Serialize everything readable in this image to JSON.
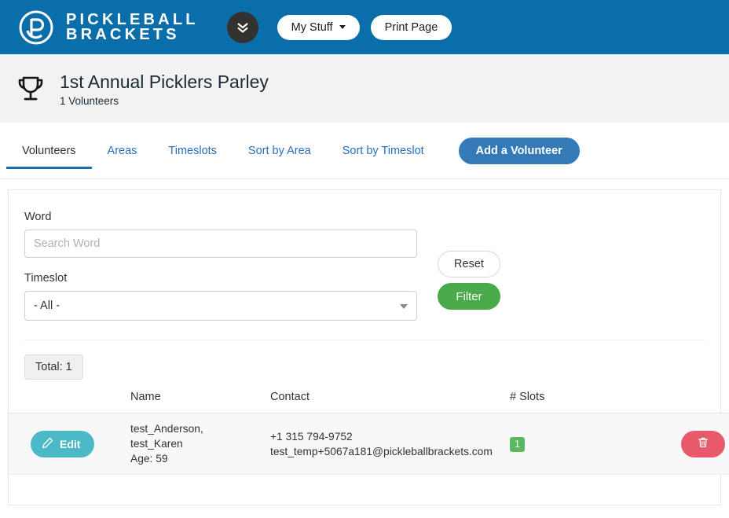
{
  "header": {
    "brand_line1": "PICKLEBALL",
    "brand_line2": "BRACKETS",
    "logo_icon": "pickleball-brackets-logo",
    "chevron_icon": "double-chevron-down-icon",
    "my_stuff_label": "My Stuff",
    "print_page_label": "Print Page",
    "brand_blue": "#0a6eab"
  },
  "event": {
    "trophy_icon": "trophy-icon",
    "title": "1st Annual Picklers Parley",
    "subtitle": "1 Volunteers"
  },
  "tabs": [
    {
      "label": "Volunteers",
      "active": true
    },
    {
      "label": "Areas",
      "active": false
    },
    {
      "label": "Timeslots",
      "active": false
    },
    {
      "label": "Sort by Area",
      "active": false
    },
    {
      "label": "Sort by Timeslot",
      "active": false
    }
  ],
  "actions": {
    "add_volunteer_label": "Add a Volunteer",
    "add_volunteer_color": "#337ab7"
  },
  "filters": {
    "word_label": "Word",
    "word_value": "",
    "word_placeholder": "Search Word",
    "timeslot_label": "Timeslot",
    "timeslot_selected": "- All -",
    "timeslot_options": [
      "- All -"
    ],
    "reset_label": "Reset",
    "filter_label": "Filter",
    "filter_color": "#49aa4a"
  },
  "results": {
    "total_label": "Total: 1",
    "columns": [
      "",
      "Name",
      "Contact",
      "# Slots",
      ""
    ],
    "rows": [
      {
        "edit_label": "Edit",
        "edit_icon": "pencil-icon",
        "edit_color": "#4cb9c7",
        "name_line1": "test_Anderson,",
        "name_line2": "test_Karen",
        "name_line3": "Age: 59",
        "contact_phone": "+1 315 794-9752",
        "contact_email": "test_temp+5067a181@pickleballbrackets.com",
        "slots": "1",
        "slots_color": "#5cb85c",
        "delete_icon": "trash-icon",
        "delete_color": "#e8596b"
      }
    ]
  }
}
